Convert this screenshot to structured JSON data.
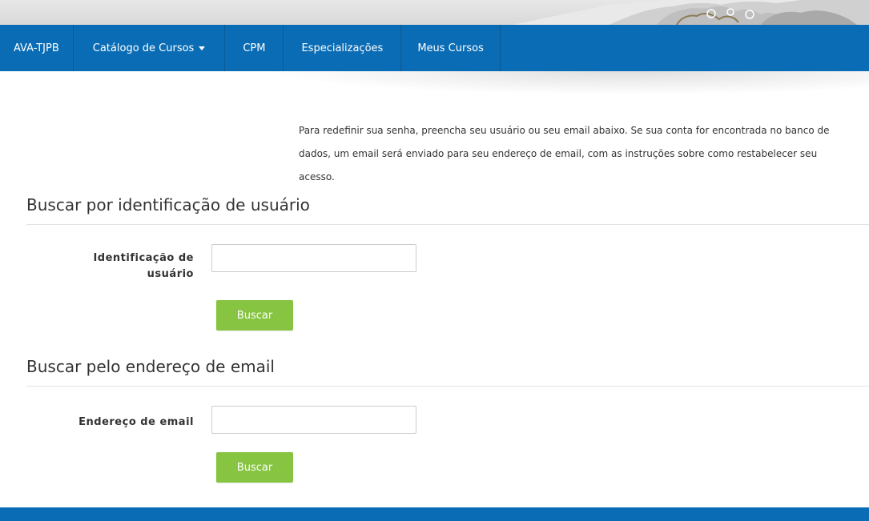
{
  "nav": {
    "items": [
      {
        "label": "AVA-TJPB"
      },
      {
        "label": "Catálogo de Cursos"
      },
      {
        "label": "CPM"
      },
      {
        "label": "Especializações"
      },
      {
        "label": "Meus Cursos"
      }
    ]
  },
  "intro": {
    "text": "Para redefinir sua senha, preencha seu usuário ou seu email abaixo. Se sua conta for encontrada no banco de dados, um email será enviado para seu endereço de email, com as instruções sobre como restabelecer seu acesso."
  },
  "username_section": {
    "title": "Buscar por identificação de usuário",
    "label_line1": "Identificação de",
    "label_line2": "usuário",
    "input_value": "",
    "button_label": "Buscar"
  },
  "email_section": {
    "title": "Buscar pelo endereço de email",
    "label": "Endereço de email",
    "input_value": "",
    "button_label": "Buscar"
  },
  "colors": {
    "navbar": "#0a6cb4",
    "button": "#86c441"
  }
}
